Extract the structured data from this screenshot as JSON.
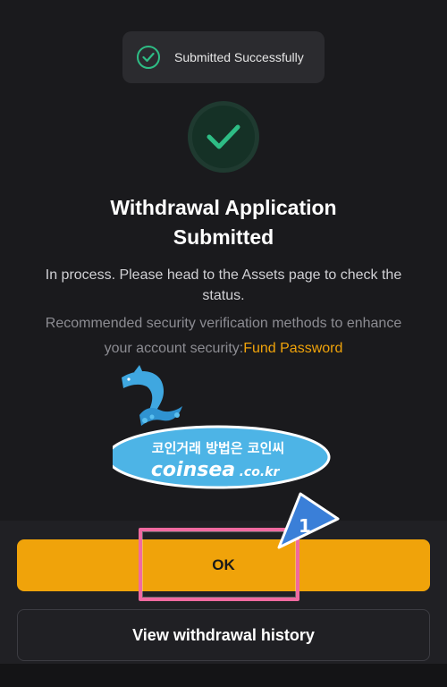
{
  "toast": {
    "message": "Submitted Successfully"
  },
  "result": {
    "title_line1": "Withdrawal Application",
    "title_line2": "Submitted",
    "description": "In process. Please head to the Assets page to check the status.",
    "recommend_text": "Recommended security verification methods to enhance your account security:",
    "recommend_link": "Fund Password"
  },
  "watermark": {
    "line1": "코인거래 방법은 코인씨",
    "line2": "coinsea",
    "line2_suffix": ".co.kr"
  },
  "actions": {
    "ok_label": "OK",
    "history_label": "View withdrawal history"
  },
  "annotation": {
    "step_number": "1"
  },
  "colors": {
    "accent": "#f0a30a",
    "success": "#2ebd85",
    "background": "#1a1a1d",
    "highlight": "#f06aa0"
  },
  "icons": [
    "check-circle-icon",
    "success-check-icon",
    "dolphin-icon"
  ]
}
